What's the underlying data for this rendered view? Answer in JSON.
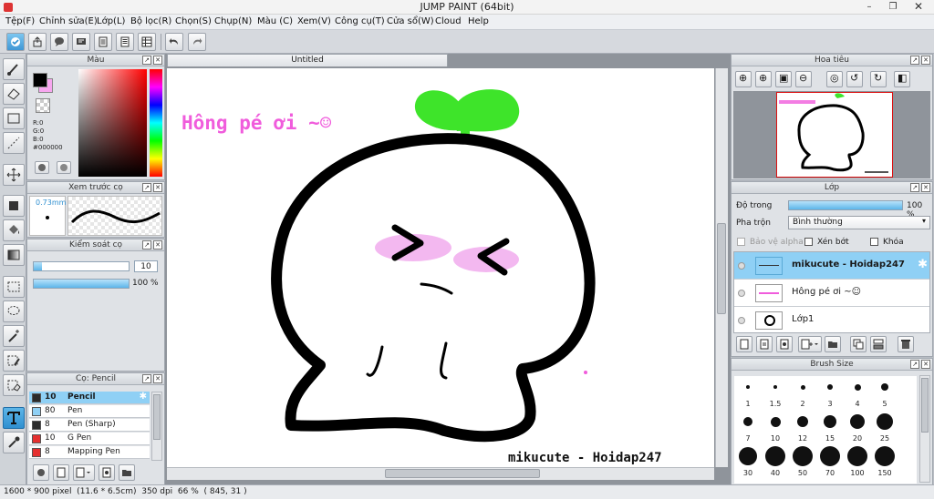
{
  "window": {
    "title": "JUMP PAINT (64bit)"
  },
  "menu": [
    "Tệp(F)",
    "Chỉnh sửa(E)",
    "Lớp(L)",
    "Bộ lọc(R)",
    "Chọn(S)",
    "Chụp(N)",
    "Màu (C)",
    "Xem(V)",
    "Công cụ(T)",
    "Cửa sổ(W)",
    "Cloud",
    "Help"
  ],
  "panels": {
    "color": {
      "title": "Màu",
      "r": "R:0",
      "g": "G:0",
      "b": "B:0",
      "hex": "#000000"
    },
    "brush_preview": {
      "title": "Xem trước cọ",
      "size": "0.73mm"
    },
    "brush_control": {
      "title": "Kiểm soát cọ",
      "size_value": "10",
      "opacity_value": "100 %"
    },
    "brush_list": {
      "title": "Cọ: Pencil",
      "items": [
        {
          "size": "10",
          "name": "Pencil",
          "color": "#2b2b2b"
        },
        {
          "size": "80",
          "name": "Pen",
          "color": "#8fd0f5"
        },
        {
          "size": "8",
          "name": "Pen (Sharp)",
          "color": "#2b2b2b"
        },
        {
          "size": "10",
          "name": "G Pen",
          "color": "#e53030"
        },
        {
          "size": "8",
          "name": "Mapping Pen",
          "color": "#e53030"
        }
      ]
    },
    "navigator": {
      "title": "Hoa tiêu"
    },
    "layer": {
      "title": "Lớp",
      "opacity_label": "Độ trong",
      "opacity_value": "100 %",
      "blend_label": "Pha trộn",
      "blend_value": "Bình thường",
      "protect_alpha": "Bảo vệ alpha",
      "clip": "Xén bớt",
      "lock": "Khóa",
      "layers": [
        "mikucute - Hoidap247",
        "Hông pé ơi ~☺",
        "Lớp1"
      ]
    },
    "brush_size": {
      "title": "Brush Size",
      "sizes": [
        "1",
        "1.5",
        "2",
        "3",
        "4",
        "5",
        "7",
        "10",
        "12",
        "15",
        "20",
        "25",
        "30",
        "40",
        "50",
        "70",
        "100",
        "150"
      ]
    }
  },
  "document": {
    "tab": "Untitled",
    "canvas_text_1": "Hông pé ơi ~☺",
    "canvas_text_2": "mikucute - Hoidap247"
  },
  "status": "1600 * 900 pixel  (11.6 * 6.5cm)  350 dpi  66 %  ( 845, 31 )",
  "colors": {
    "accent": "#2f8fd0",
    "selection": "#8fd0f5",
    "pink_text": "#f05cdc",
    "sprout": "#3ee42a"
  }
}
